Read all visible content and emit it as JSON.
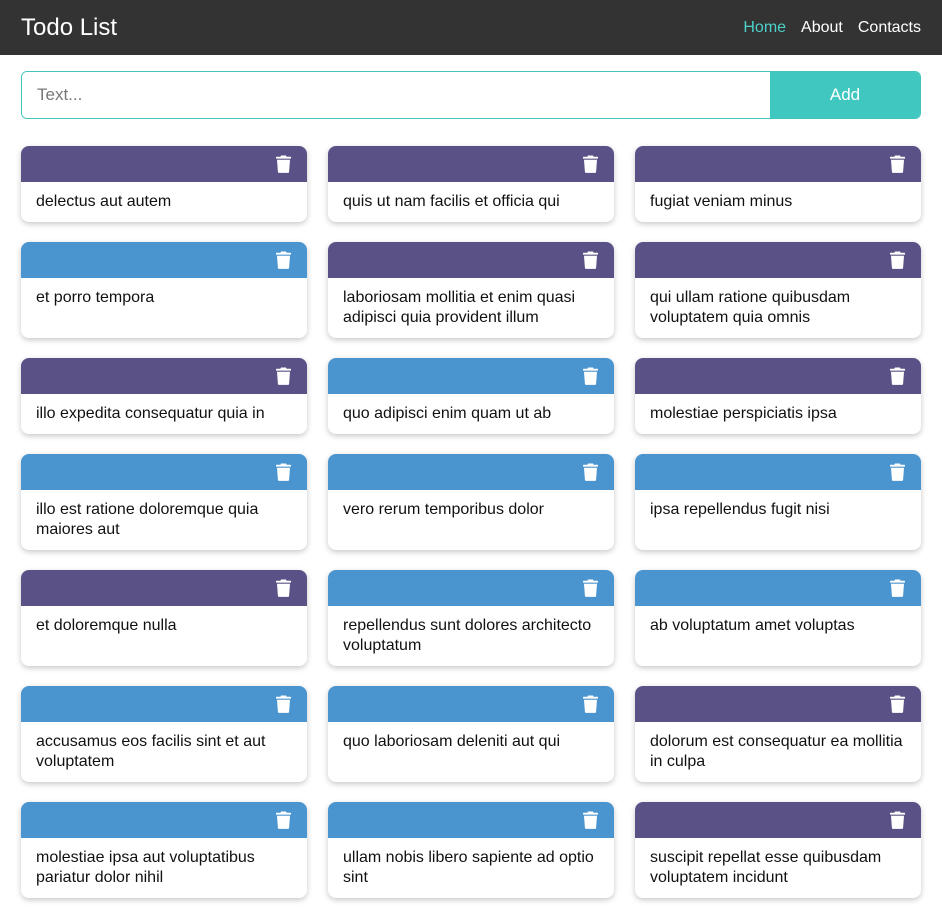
{
  "app": {
    "title": "Todo List"
  },
  "nav": {
    "links": [
      "Home",
      "About",
      "Contacts"
    ],
    "active": "Home"
  },
  "form": {
    "placeholder": "Text...",
    "button_label": "Add"
  },
  "colors": {
    "navbar": "#333333",
    "accent": "#40c7c0",
    "purple": "#5a5286",
    "blue": "#4a95cf"
  },
  "todos": [
    {
      "text": "delectus aut autem",
      "color": "purple"
    },
    {
      "text": "quis ut nam facilis et officia qui",
      "color": "purple"
    },
    {
      "text": "fugiat veniam minus",
      "color": "purple"
    },
    {
      "text": "et porro tempora",
      "color": "blue"
    },
    {
      "text": "laboriosam mollitia et enim quasi adipisci quia provident illum",
      "color": "purple"
    },
    {
      "text": "qui ullam ratione quibusdam voluptatem quia omnis",
      "color": "purple"
    },
    {
      "text": "illo expedita consequatur quia in",
      "color": "purple"
    },
    {
      "text": "quo adipisci enim quam ut ab",
      "color": "blue"
    },
    {
      "text": "molestiae perspiciatis ipsa",
      "color": "purple"
    },
    {
      "text": "illo est ratione doloremque quia maiores aut",
      "color": "blue"
    },
    {
      "text": "vero rerum temporibus dolor",
      "color": "blue"
    },
    {
      "text": "ipsa repellendus fugit nisi",
      "color": "blue"
    },
    {
      "text": "et doloremque nulla",
      "color": "purple"
    },
    {
      "text": "repellendus sunt dolores architecto voluptatum",
      "color": "blue"
    },
    {
      "text": "ab voluptatum amet voluptas",
      "color": "blue"
    },
    {
      "text": "accusamus eos facilis sint et aut voluptatem",
      "color": "blue"
    },
    {
      "text": "quo laboriosam deleniti aut qui",
      "color": "blue"
    },
    {
      "text": "dolorum est consequatur ea mollitia in culpa",
      "color": "purple"
    },
    {
      "text": "molestiae ipsa aut voluptatibus pariatur dolor nihil",
      "color": "blue"
    },
    {
      "text": "ullam nobis libero sapiente ad optio sint",
      "color": "blue"
    },
    {
      "text": "suscipit repellat esse quibusdam voluptatem incidunt",
      "color": "purple"
    }
  ]
}
